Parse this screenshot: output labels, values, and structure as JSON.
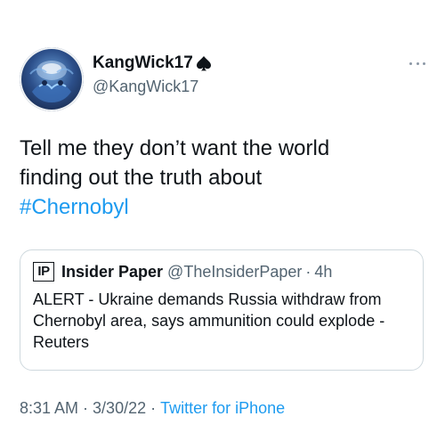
{
  "author": {
    "display_name": "KangWick17",
    "handle": "@KangWick17",
    "name_badge": "spade-icon"
  },
  "tweet": {
    "text_line1": "Tell me they don’t want the world",
    "text_line2": "finding out the truth about",
    "hashtag": "#Chernobyl"
  },
  "quote": {
    "logo_text": "IP",
    "name": "Insider Paper",
    "handle": "@TheInsiderPaper",
    "separator": "·",
    "time": "4h",
    "body": "ALERT - Ukraine demands Russia withdraw from Chernobyl area, says ammunition could explode - Reuters"
  },
  "meta": {
    "time": "8:31 AM",
    "separator": "·",
    "date": "3/30/22",
    "source": "Twitter for iPhone"
  },
  "colors": {
    "link": "#1d9bf0",
    "secondary_text": "#536471",
    "border": "#cfd9de"
  }
}
